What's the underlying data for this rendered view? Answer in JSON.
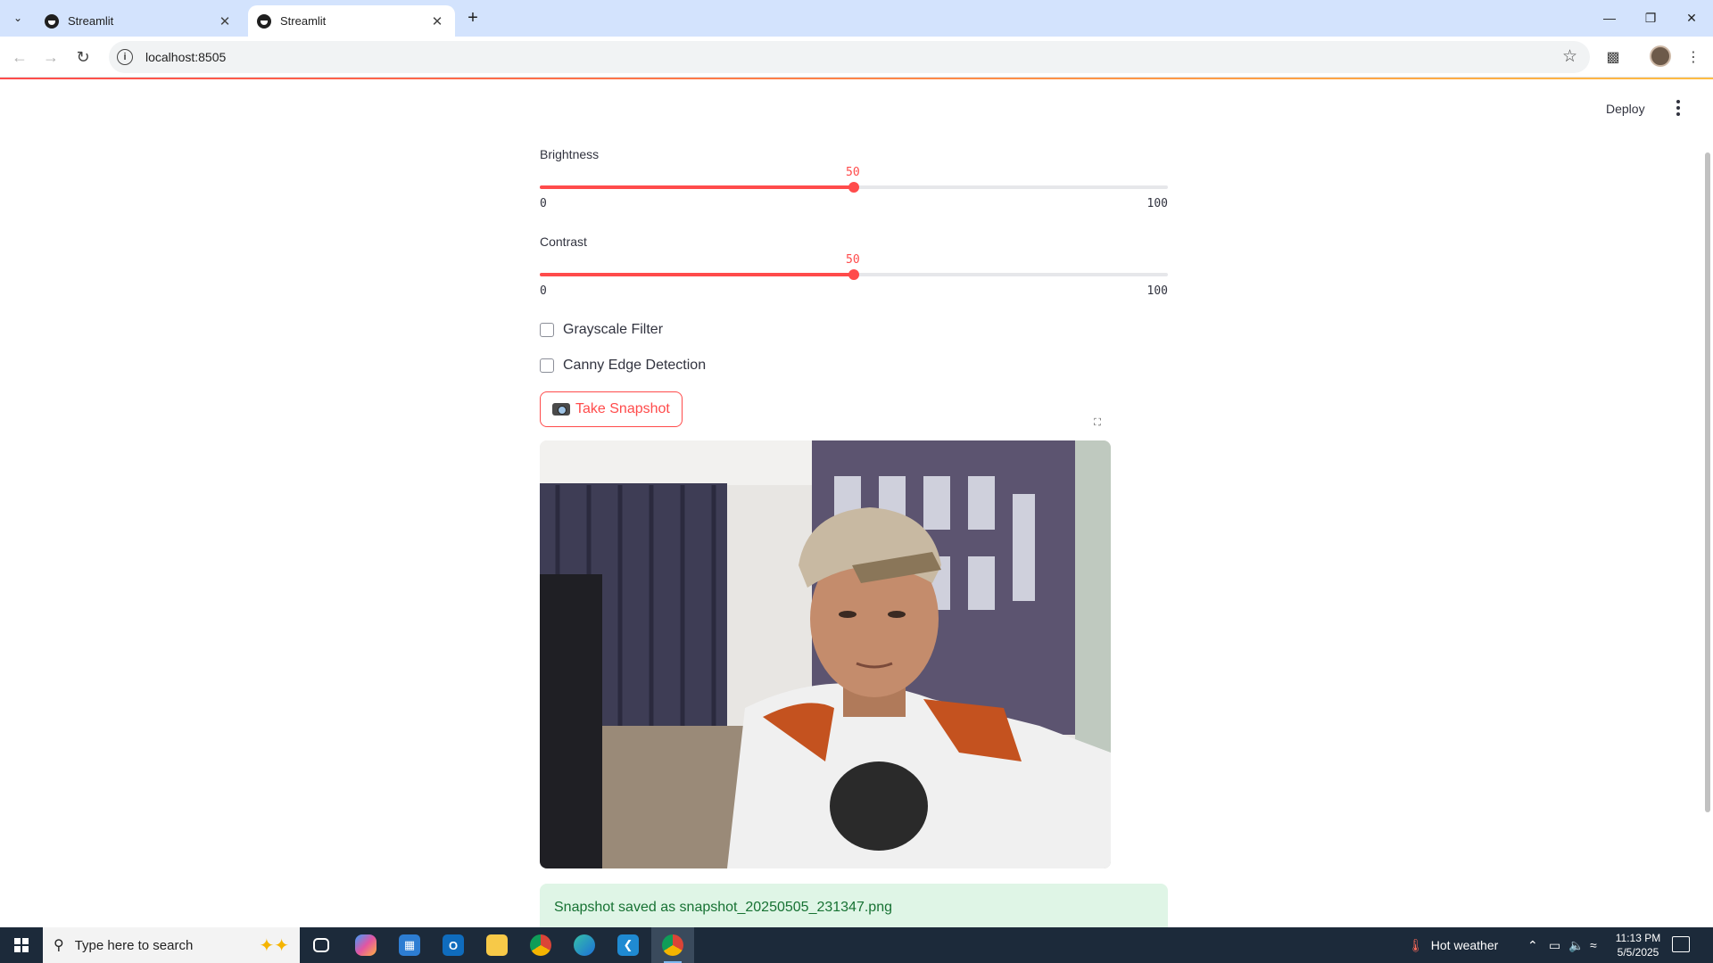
{
  "browser": {
    "tabs": [
      {
        "title": "Streamlit",
        "active": false
      },
      {
        "title": "Streamlit",
        "active": true
      }
    ],
    "url": "localhost:8505",
    "icons": [
      "tab-search-icon",
      "back-icon",
      "forward-icon",
      "reload-icon",
      "site-info-icon",
      "bookmark-star-icon",
      "extensions-icon",
      "profile-avatar",
      "chrome-menu-icon",
      "minimize-icon",
      "restore-icon",
      "close-icon",
      "new-tab-icon"
    ]
  },
  "app": {
    "deploy_label": "Deploy",
    "sliders": [
      {
        "label": "Brightness",
        "value": "50",
        "min": "0",
        "max": "100",
        "fraction": 0.5
      },
      {
        "label": "Contrast",
        "value": "50",
        "min": "0",
        "max": "100",
        "fraction": 0.5
      }
    ],
    "checkboxes": [
      {
        "label": "Grayscale Filter",
        "checked": false
      },
      {
        "label": "Canny Edge Detection",
        "checked": false
      }
    ],
    "snapshot_button": "Take Snapshot",
    "success_message": "Snapshot saved as snapshot_20250505_231347.png",
    "accent_color": "#ff4b4b"
  },
  "taskbar": {
    "search_placeholder": "Type here to search",
    "weather": "Hot weather",
    "time": "11:13 PM",
    "date": "5/5/2025",
    "apps": [
      "task-view-icon",
      "copilot-icon",
      "store-icon",
      "outlook-icon",
      "file-explorer-icon",
      "chrome-icon",
      "edge-icon",
      "vscode-icon",
      "chrome-profile-icon"
    ]
  }
}
